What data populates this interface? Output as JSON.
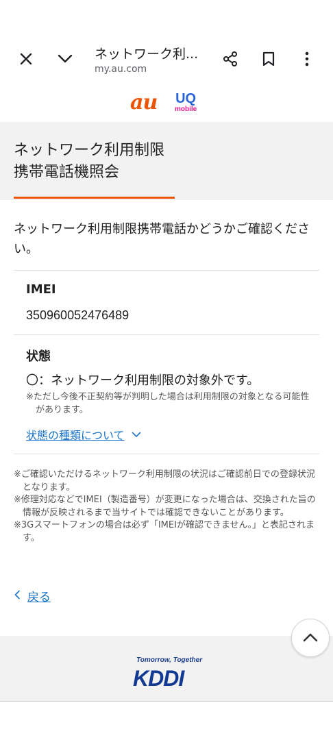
{
  "browser": {
    "title": "ネットワーク利...",
    "url": "my.au.com",
    "icons": [
      "close-icon",
      "chevron-down-icon",
      "share-icon",
      "bookmark-icon",
      "more-vert-icon"
    ]
  },
  "logos": {
    "au": "au",
    "uq": "UQ",
    "uq_sub": "mobile"
  },
  "header": {
    "title": "ネットワーク利用制限\n携帯電話機照会"
  },
  "intro": "ネットワーク利用制限携帯電話かどうかご確認ください。",
  "imei": {
    "label": "IMEI",
    "value": "350960052476489"
  },
  "status": {
    "label": "状態",
    "value": "〇：ネットワーク利用制限の対象外です。",
    "note": "※ただし今後不正契約等が判明した場合は利用制限の対象となる可能性があります。",
    "link": "状態の種類について"
  },
  "notes": [
    "※ご確認いただけるネットワーク利用制限の状況はご確認前日での登録状況となります。",
    "※修理対応などでIMEI（製造番号）が変更になった場合は、交換された旨の情報が反映されるまで当サイトでは確認できないことがあります。",
    "※3Gスマートフォンの場合は必ず「IMEIが確認できません。」と表記されます。"
  ],
  "back": "戻る",
  "footer": {
    "slogan": "Tomorrow, Together",
    "logo": "KDDI"
  },
  "colors": {
    "accent": "#eb5505",
    "link": "#1a73c8",
    "kddi_blue": "#123a92"
  }
}
